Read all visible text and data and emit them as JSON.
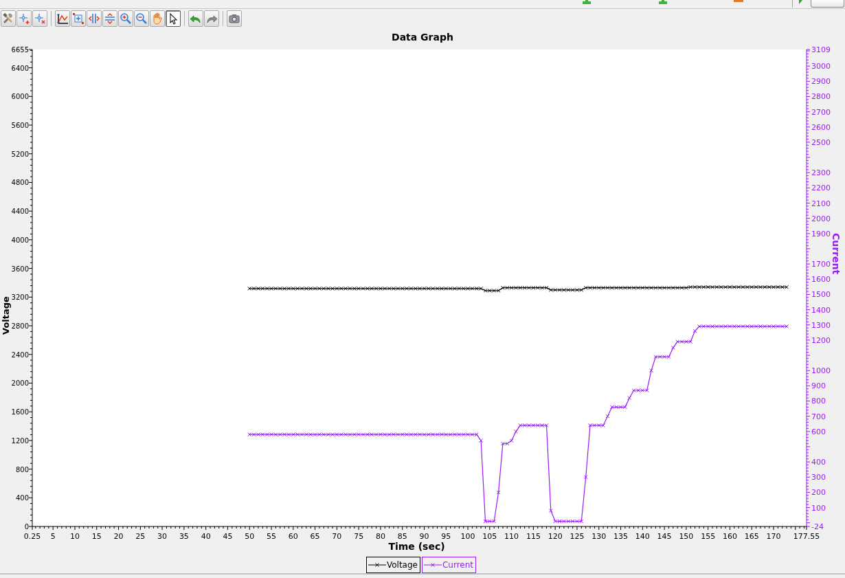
{
  "top_bar": {
    "items": [
      {
        "kind": "add"
      },
      {
        "kind": "add"
      },
      {
        "kind": "remove"
      },
      {
        "kind": "separator"
      },
      {
        "kind": "run"
      },
      {
        "kind": "dropdown"
      }
    ]
  },
  "toolbar": {
    "groups": [
      [
        {
          "kind": "tools",
          "selected": false
        },
        {
          "kind": "add-cursor",
          "selected": false
        },
        {
          "kind": "remove-cursor",
          "selected": false
        }
      ],
      [
        {
          "kind": "autoscale",
          "selected": false
        },
        {
          "kind": "zoom-box",
          "selected": false
        },
        {
          "kind": "fit-horizontal",
          "selected": false
        },
        {
          "kind": "fit-vertical",
          "selected": false
        },
        {
          "kind": "zoom-in",
          "selected": false
        },
        {
          "kind": "zoom-out",
          "selected": false
        },
        {
          "kind": "pan",
          "selected": false
        },
        {
          "kind": "pointer",
          "selected": true
        }
      ],
      [
        {
          "kind": "undo",
          "selected": false
        },
        {
          "kind": "redo",
          "selected": false
        }
      ],
      [
        {
          "kind": "snapshot",
          "selected": false
        }
      ]
    ]
  },
  "graph": {
    "chart_data": {
      "type": "line",
      "title": "Data Graph",
      "xlabel": "Time (sec)",
      "ylabel": "Voltage",
      "y2label": "Current",
      "xlim": [
        0.25,
        177.55
      ],
      "ylim": [
        0,
        6655
      ],
      "y2lim": [
        -24,
        3109
      ],
      "xticks": [
        0.25,
        5,
        10,
        15,
        20,
        25,
        30,
        35,
        40,
        45,
        50,
        55,
        60,
        65,
        70,
        75,
        80,
        85,
        90,
        95,
        100,
        105,
        110,
        115,
        120,
        125,
        130,
        135,
        140,
        145,
        150,
        155,
        160,
        165,
        170,
        177.55
      ],
      "yticks": [
        0,
        400,
        800,
        1200,
        1600,
        2000,
        2400,
        2800,
        3200,
        3600,
        4000,
        4400,
        4800,
        5200,
        5600,
        6000,
        6400,
        6655
      ],
      "y2ticks": [
        -24,
        100,
        200,
        300,
        400,
        600,
        700,
        800,
        900,
        1000,
        1200,
        1300,
        1400,
        1500,
        1600,
        1700,
        1900,
        2000,
        2100,
        2200,
        2300,
        2500,
        2600,
        2700,
        2800,
        2900,
        3000,
        3109
      ],
      "x": [
        50,
        51,
        52,
        53,
        54,
        55,
        56,
        57,
        58,
        59,
        60,
        61,
        62,
        63,
        64,
        65,
        66,
        67,
        68,
        69,
        70,
        71,
        72,
        73,
        74,
        75,
        76,
        77,
        78,
        79,
        80,
        81,
        82,
        83,
        84,
        85,
        86,
        87,
        88,
        89,
        90,
        91,
        92,
        93,
        94,
        95,
        96,
        97,
        98,
        99,
        100,
        101,
        102,
        103,
        104,
        105,
        106,
        107,
        108,
        109,
        110,
        111,
        112,
        113,
        114,
        115,
        116,
        117,
        118,
        119,
        120,
        121,
        122,
        123,
        124,
        125,
        126,
        127,
        128,
        129,
        130,
        131,
        132,
        133,
        134,
        135,
        136,
        137,
        138,
        139,
        140,
        141,
        142,
        143,
        144,
        145,
        146,
        147,
        148,
        149,
        150,
        151,
        152,
        153,
        154,
        155,
        156,
        157,
        158,
        159,
        160,
        161,
        162,
        163,
        164,
        165,
        166,
        167,
        168,
        169,
        170,
        171,
        172,
        173
      ],
      "series": [
        {
          "name": "Voltage",
          "color": "#000000",
          "values": [
            3320,
            3320,
            3320,
            3320,
            3320,
            3320,
            3320,
            3320,
            3320,
            3320,
            3320,
            3320,
            3320,
            3320,
            3320,
            3320,
            3320,
            3320,
            3320,
            3320,
            3320,
            3320,
            3320,
            3320,
            3320,
            3320,
            3320,
            3320,
            3320,
            3320,
            3320,
            3320,
            3320,
            3320,
            3320,
            3320,
            3320,
            3320,
            3320,
            3320,
            3320,
            3320,
            3320,
            3320,
            3320,
            3320,
            3320,
            3320,
            3320,
            3320,
            3320,
            3320,
            3320,
            3320,
            3290,
            3290,
            3290,
            3290,
            3330,
            3330,
            3330,
            3330,
            3330,
            3330,
            3330,
            3330,
            3330,
            3330,
            3330,
            3300,
            3300,
            3300,
            3300,
            3300,
            3300,
            3300,
            3300,
            3330,
            3330,
            3330,
            3330,
            3330,
            3330,
            3330,
            3330,
            3330,
            3330,
            3330,
            3330,
            3330,
            3330,
            3330,
            3330,
            3330,
            3330,
            3330,
            3330,
            3330,
            3330,
            3330,
            3330,
            3340,
            3340,
            3340,
            3340,
            3340,
            3340,
            3340,
            3340,
            3340,
            3340,
            3340,
            3340,
            3340,
            3340,
            3340,
            3340,
            3340,
            3340,
            3340,
            3340,
            3340,
            3340,
            3340
          ]
        },
        {
          "name": "Current",
          "color": "#9a1cf5",
          "axis": "y2",
          "values": [
            580,
            580,
            580,
            580,
            580,
            580,
            580,
            580,
            580,
            580,
            580,
            580,
            580,
            580,
            580,
            580,
            580,
            580,
            580,
            580,
            580,
            580,
            580,
            580,
            580,
            580,
            580,
            580,
            580,
            580,
            580,
            580,
            580,
            580,
            580,
            580,
            580,
            580,
            580,
            580,
            580,
            580,
            580,
            580,
            580,
            580,
            580,
            580,
            580,
            580,
            580,
            580,
            580,
            540,
            10,
            10,
            10,
            200,
            520,
            520,
            540,
            600,
            640,
            640,
            640,
            640,
            640,
            640,
            640,
            80,
            10,
            10,
            10,
            10,
            10,
            10,
            10,
            300,
            640,
            640,
            640,
            640,
            700,
            760,
            760,
            760,
            760,
            820,
            870,
            870,
            870,
            870,
            1000,
            1090,
            1090,
            1090,
            1090,
            1150,
            1190,
            1190,
            1190,
            1190,
            1260,
            1290,
            1290,
            1290,
            1290,
            1290,
            1290,
            1290,
            1290,
            1290,
            1290,
            1290,
            1290,
            1290,
            1290,
            1290,
            1290,
            1290,
            1290,
            1290,
            1290,
            1290
          ]
        }
      ]
    }
  }
}
